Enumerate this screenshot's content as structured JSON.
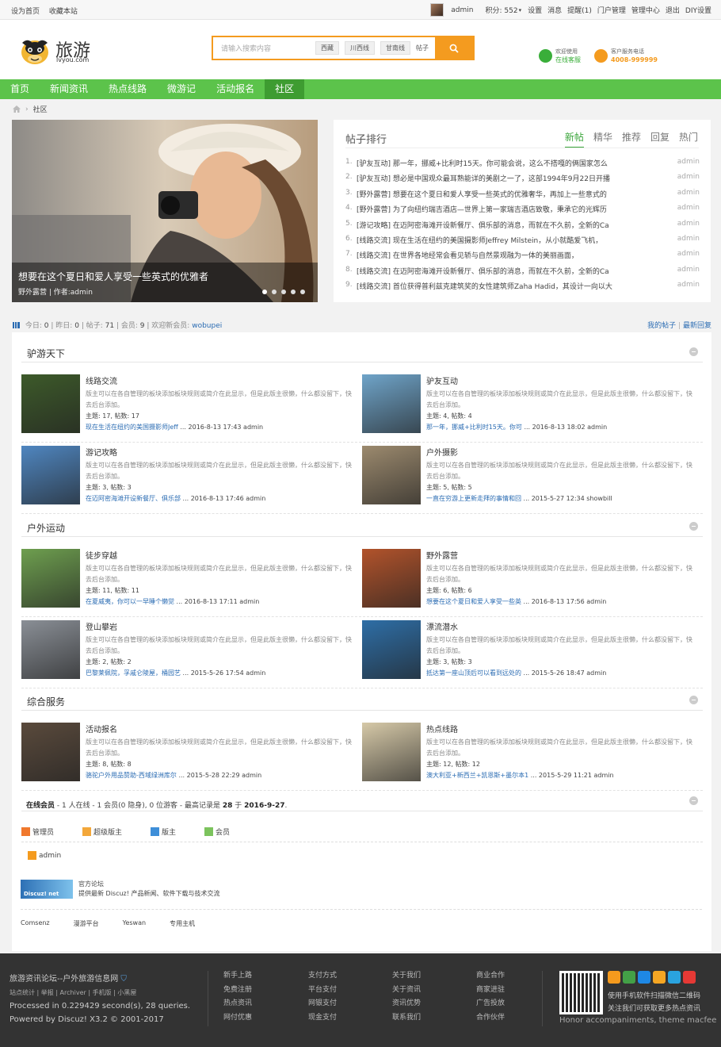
{
  "topbar": {
    "left_links": [
      "设为首页",
      "收藏本站"
    ],
    "username": "admin",
    "points": "积分: 552",
    "links": [
      "设置",
      "消息",
      "提醒(1)",
      "门户管理",
      "管理中心",
      "退出",
      "DIY设置"
    ]
  },
  "header": {
    "logo_text": "旅游",
    "logo_sub": "lvyou.com",
    "search_placeholder": "请输入搜索内容",
    "search_tags": [
      "西藏",
      "川西线",
      "甘南线"
    ],
    "search_type": "帖子",
    "online_service": {
      "line1": "欢迎使用",
      "line2": "在线客服"
    },
    "phone_service": {
      "line1": "客户服务电话",
      "line2": "4008-999999"
    }
  },
  "nav": {
    "items": [
      "首页",
      "新闻资讯",
      "热点线路",
      "微游记",
      "活动报名",
      "社区"
    ],
    "active_index": 5
  },
  "breadcrumb": {
    "current": "社区"
  },
  "slide": {
    "caption": "想要在这个夏日和爱人享受一些英式的优雅者",
    "meta": "野外露营 | 作者:admin",
    "dots": 5,
    "active_dot": 0
  },
  "rank": {
    "title": "帖子排行",
    "tabs": [
      "新帖",
      "精华",
      "推荐",
      "回复",
      "热门"
    ],
    "active_tab": 0,
    "rows": [
      {
        "n": "1.",
        "text": "[驴友互动] 那一年，挪威+比利时15天。你可能会说，这么不搭嘎的俩国家怎么",
        "author": "admin"
      },
      {
        "n": "2.",
        "text": "[驴友互动] 想必是中国观众最耳熟能详的美剧之一了，这部1994年9月22日开播",
        "author": "admin"
      },
      {
        "n": "3.",
        "text": "[野外露营] 想要在这个夏日和爱人享受一些英式的优雅奢华，再加上一些意式的",
        "author": "admin"
      },
      {
        "n": "4.",
        "text": "[野外露营] 为了向纽约瑞吉酒店—世界上第一家瑞吉酒店致敬，秉承它的光辉历",
        "author": "admin"
      },
      {
        "n": "5.",
        "text": "[游记攻略] 在迈阿密海滩开设新餐厅、俱乐部的消息，而就在不久前，全新的Ca",
        "author": "admin"
      },
      {
        "n": "6.",
        "text": "[线路交流] 现在生活在纽约的美国摄影师Jeffrey Milstein，从小就酷爱飞机，",
        "author": "admin"
      },
      {
        "n": "7.",
        "text": "[线路交流] 在世界各地经常会看见轿与自然景观融为一体的美丽画面，",
        "author": "admin"
      },
      {
        "n": "8.",
        "text": "[线路交流] 在迈阿密海滩开设新餐厅、俱乐部的消息，而就在不久前，全新的Ca",
        "author": "admin"
      },
      {
        "n": "9.",
        "text": "[线路交流] 首位获得普利兹克建筑奖的女性建筑师Zaha Hadid，其设计一向以大",
        "author": "admin"
      }
    ]
  },
  "stats": {
    "today_label": "今日:",
    "today": "0",
    "yesterday_label": "昨日:",
    "yesterday": "0",
    "posts_label": "帖子:",
    "posts": "71",
    "members_label": "会员:",
    "members": "9",
    "newest_label": "欢迎新会员:",
    "newest": "wobupei",
    "right_links": [
      "我的帖子",
      "最新回复"
    ]
  },
  "forum_desc": "版主可以在各自管理的板块添加板块规则或简介在此显示，但是此版主很懒，什么都没留下，快去后台添加。",
  "sections": [
    {
      "title": "驴游天下",
      "forums": [
        {
          "name": "线路交流",
          "counts": "主题: 17, 帖数: 17",
          "last_link": "现在生活在纽约的美国摄影师Jeff",
          "last_meta": "... 2016-8-13 17:43 admin",
          "color": "#3d5a2a"
        },
        {
          "name": "驴友互动",
          "counts": "主题: 4, 帖数: 4",
          "last_link": "那一年，挪威+比利时15天。你可",
          "last_meta": "... 2016-8-13 18:02 admin",
          "color": "#6fa4c9"
        },
        {
          "name": "游记攻略",
          "counts": "主题: 3, 帖数: 3",
          "last_link": "在迈阿密海滩开设新餐厅、俱乐部",
          "last_meta": "... 2016-8-13 17:46 admin",
          "color": "#4f86c0"
        },
        {
          "name": "户外摄影",
          "counts": "主题: 5, 帖数: 5",
          "last_link": "一直在穷游上更新走拜的事情和回",
          "last_meta": "... 2015-5-27 12:34 showbill",
          "color": "#9c8a6e"
        }
      ]
    },
    {
      "title": "户外运动",
      "forums": [
        {
          "name": "徒步穿越",
          "counts": "主题: 11, 帖数: 11",
          "last_link": "在夏威夷，你可以一早睡个懒觉",
          "last_meta": "... 2016-8-13 17:11 admin",
          "color": "#6e9f4f"
        },
        {
          "name": "野外露营",
          "counts": "主题: 6, 帖数: 6",
          "last_link": "想要在这个夏日和爱人享受一些英",
          "last_meta": "... 2016-8-13 17:56 admin",
          "color": "#b2532b"
        },
        {
          "name": "登山攀岩",
          "counts": "主题: 2, 帖数: 2",
          "last_link": "巴黎莱佩院，孚戚仑陵屋，桶园艺",
          "last_meta": "... 2015-5-26 17:54 admin",
          "color": "#8a8f96"
        },
        {
          "name": "漂流潜水",
          "counts": "主题: 3, 帖数: 3",
          "last_link": "抵达第一座山顶后可以看到远处的",
          "last_meta": "... 2015-5-26 18:47 admin",
          "color": "#2e6ea6"
        }
      ]
    },
    {
      "title": "综合服务",
      "forums": [
        {
          "name": "活动报名",
          "counts": "主题: 8, 帖数: 8",
          "last_link": "骆驼户外用品赞助-西域绿洲库尔",
          "last_meta": "... 2015-5-28 22:29 admin",
          "color": "#5a4a3c"
        },
        {
          "name": "热点线路",
          "counts": "主题: 12, 帖数: 12",
          "last_link": "澳大利亚+新西兰+凯恩斯+墨尔本1",
          "last_meta": "... 2015-5-29 11:21 admin",
          "color": "#d6c9a8"
        }
      ]
    }
  ],
  "online": {
    "label": "在线会员",
    "text": " - 1 人在线 - 1 会员(0 隐身), 0 位游客 - 最高记录是 ",
    "record": "28",
    "at": " 于 ",
    "date": "2016-9-27",
    "end": "."
  },
  "legend": [
    {
      "label": "管理员",
      "color": "#f0782d"
    },
    {
      "label": "超级版主",
      "color": "#f3a73a"
    },
    {
      "label": "版主",
      "color": "#3e8ed8"
    },
    {
      "label": "会员",
      "color": "#7cc35d"
    }
  ],
  "online_user": "admin",
  "official": {
    "badge": "Discuz! net",
    "title": "官方论坛",
    "desc": "提供最新 Discuz! 产品新闻、软件下载与技术交流"
  },
  "friend_links": [
    "Comsenz",
    "漫游平台",
    "Yeswan",
    "专用主机"
  ],
  "footer": {
    "site": "旅游资讯论坛--户外旅游信息网",
    "sub_links": "站点统计 | 举报 | Archiver | 手机版 | 小黑屋",
    "processed": "Processed in 0.229429 second(s), 28 queries.",
    "powered": "Powered by Discuz! X3.2 © 2001-2017",
    "columns": [
      [
        "新手上路",
        "免费注册",
        "热点资讯",
        "网付优惠"
      ],
      [
        "支付方式",
        "平台支付",
        "网银支付",
        "现金支付"
      ],
      [
        "关于我们",
        "关于资讯",
        "资讯优势",
        "联系我们"
      ],
      [
        "商业合作",
        "商家进驻",
        "广告投放",
        "合作伙伴"
      ]
    ],
    "qr_text1": "使用手机软件扫描微信二维码",
    "qr_text2": "关注我们可获取更多热点资讯",
    "honor": "Honor accompaniments, theme macfee",
    "social_colors": [
      "#f59a1d",
      "#43a047",
      "#1e88e5",
      "#f5a623",
      "#2aa3df",
      "#e53935"
    ]
  }
}
